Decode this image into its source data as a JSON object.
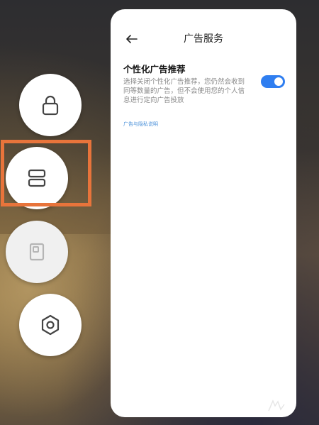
{
  "colors": {
    "accent": "#2f7ef0",
    "highlight": "#e8743b",
    "link": "#4a90d9"
  },
  "controls": [
    {
      "icon": "lock-icon"
    },
    {
      "icon": "split-screen-icon"
    },
    {
      "icon": "floating-window-icon"
    },
    {
      "icon": "settings-hexagon-icon"
    }
  ],
  "page": {
    "title": "广告服务",
    "back_icon": "back-arrow-icon"
  },
  "setting": {
    "title": "个性化广告推荐",
    "description": "选择关闭个性化广告推荐，您仍然会收到同等数量的广告，但不会使用您的个人信息进行定向广告投放",
    "enabled": true
  },
  "link": {
    "label": "广告与隐私说明"
  }
}
